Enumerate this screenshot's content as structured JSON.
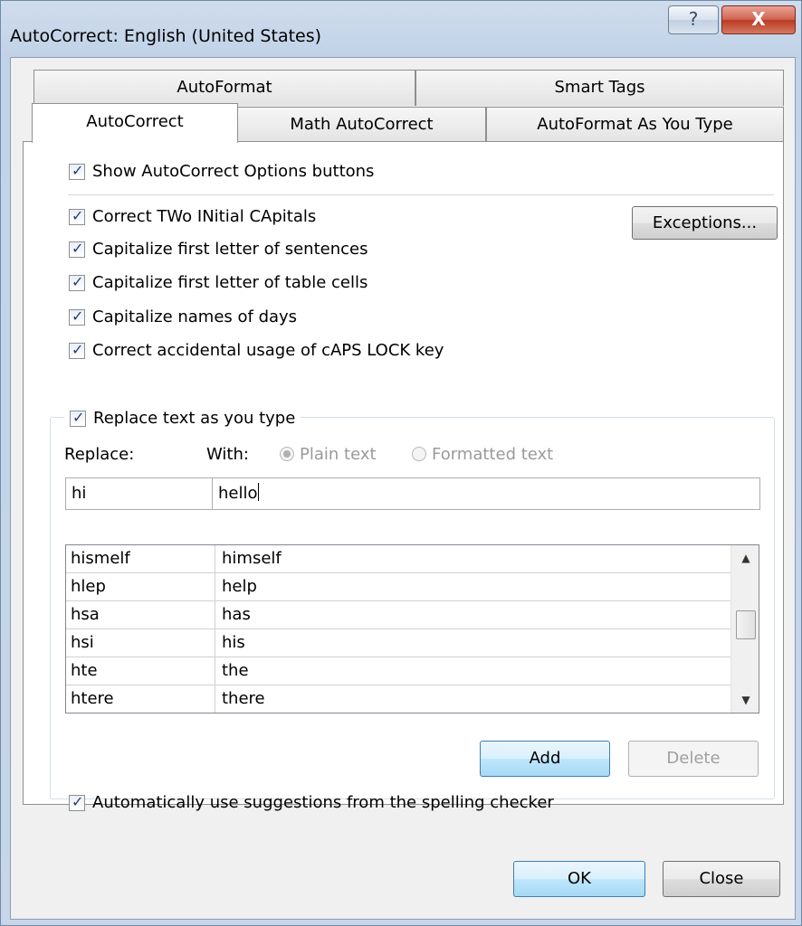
{
  "window": {
    "title": "AutoCorrect: English (United States)",
    "help_glyph": "?",
    "close_glyph": "X"
  },
  "tabs": {
    "row1": [
      "AutoFormat",
      "Smart Tags"
    ],
    "row2": [
      "AutoCorrect",
      "Math AutoCorrect",
      "AutoFormat As You Type"
    ],
    "active": "AutoCorrect"
  },
  "options": {
    "show_buttons": "Show AutoCorrect Options buttons",
    "correct_two_initial": "Correct TWo INitial CApitals",
    "cap_sentences": "Capitalize first letter of sentences",
    "cap_table_cells": "Capitalize first letter of table cells",
    "cap_days": "Capitalize names of days",
    "caps_lock": "Correct accidental usage of cAPS LOCK key",
    "exceptions_button": "Exceptions..."
  },
  "replace": {
    "checkbox": "Replace text as you type",
    "replace_label": "Replace:",
    "with_label": "With:",
    "plain_text": "Plain text",
    "formatted_text": "Formatted text",
    "replace_value": "hi",
    "with_value": "hello",
    "entries": [
      {
        "from": "hismelf",
        "to": "himself"
      },
      {
        "from": "hlep",
        "to": "help"
      },
      {
        "from": "hsa",
        "to": "has"
      },
      {
        "from": "hsi",
        "to": "his"
      },
      {
        "from": "hte",
        "to": "the"
      },
      {
        "from": "htere",
        "to": "there"
      }
    ],
    "add_button": "Add",
    "delete_button": "Delete",
    "auto_suggest": "Automatically use suggestions from the spelling checker"
  },
  "footer": {
    "ok_button": "OK",
    "close_button": "Close"
  }
}
